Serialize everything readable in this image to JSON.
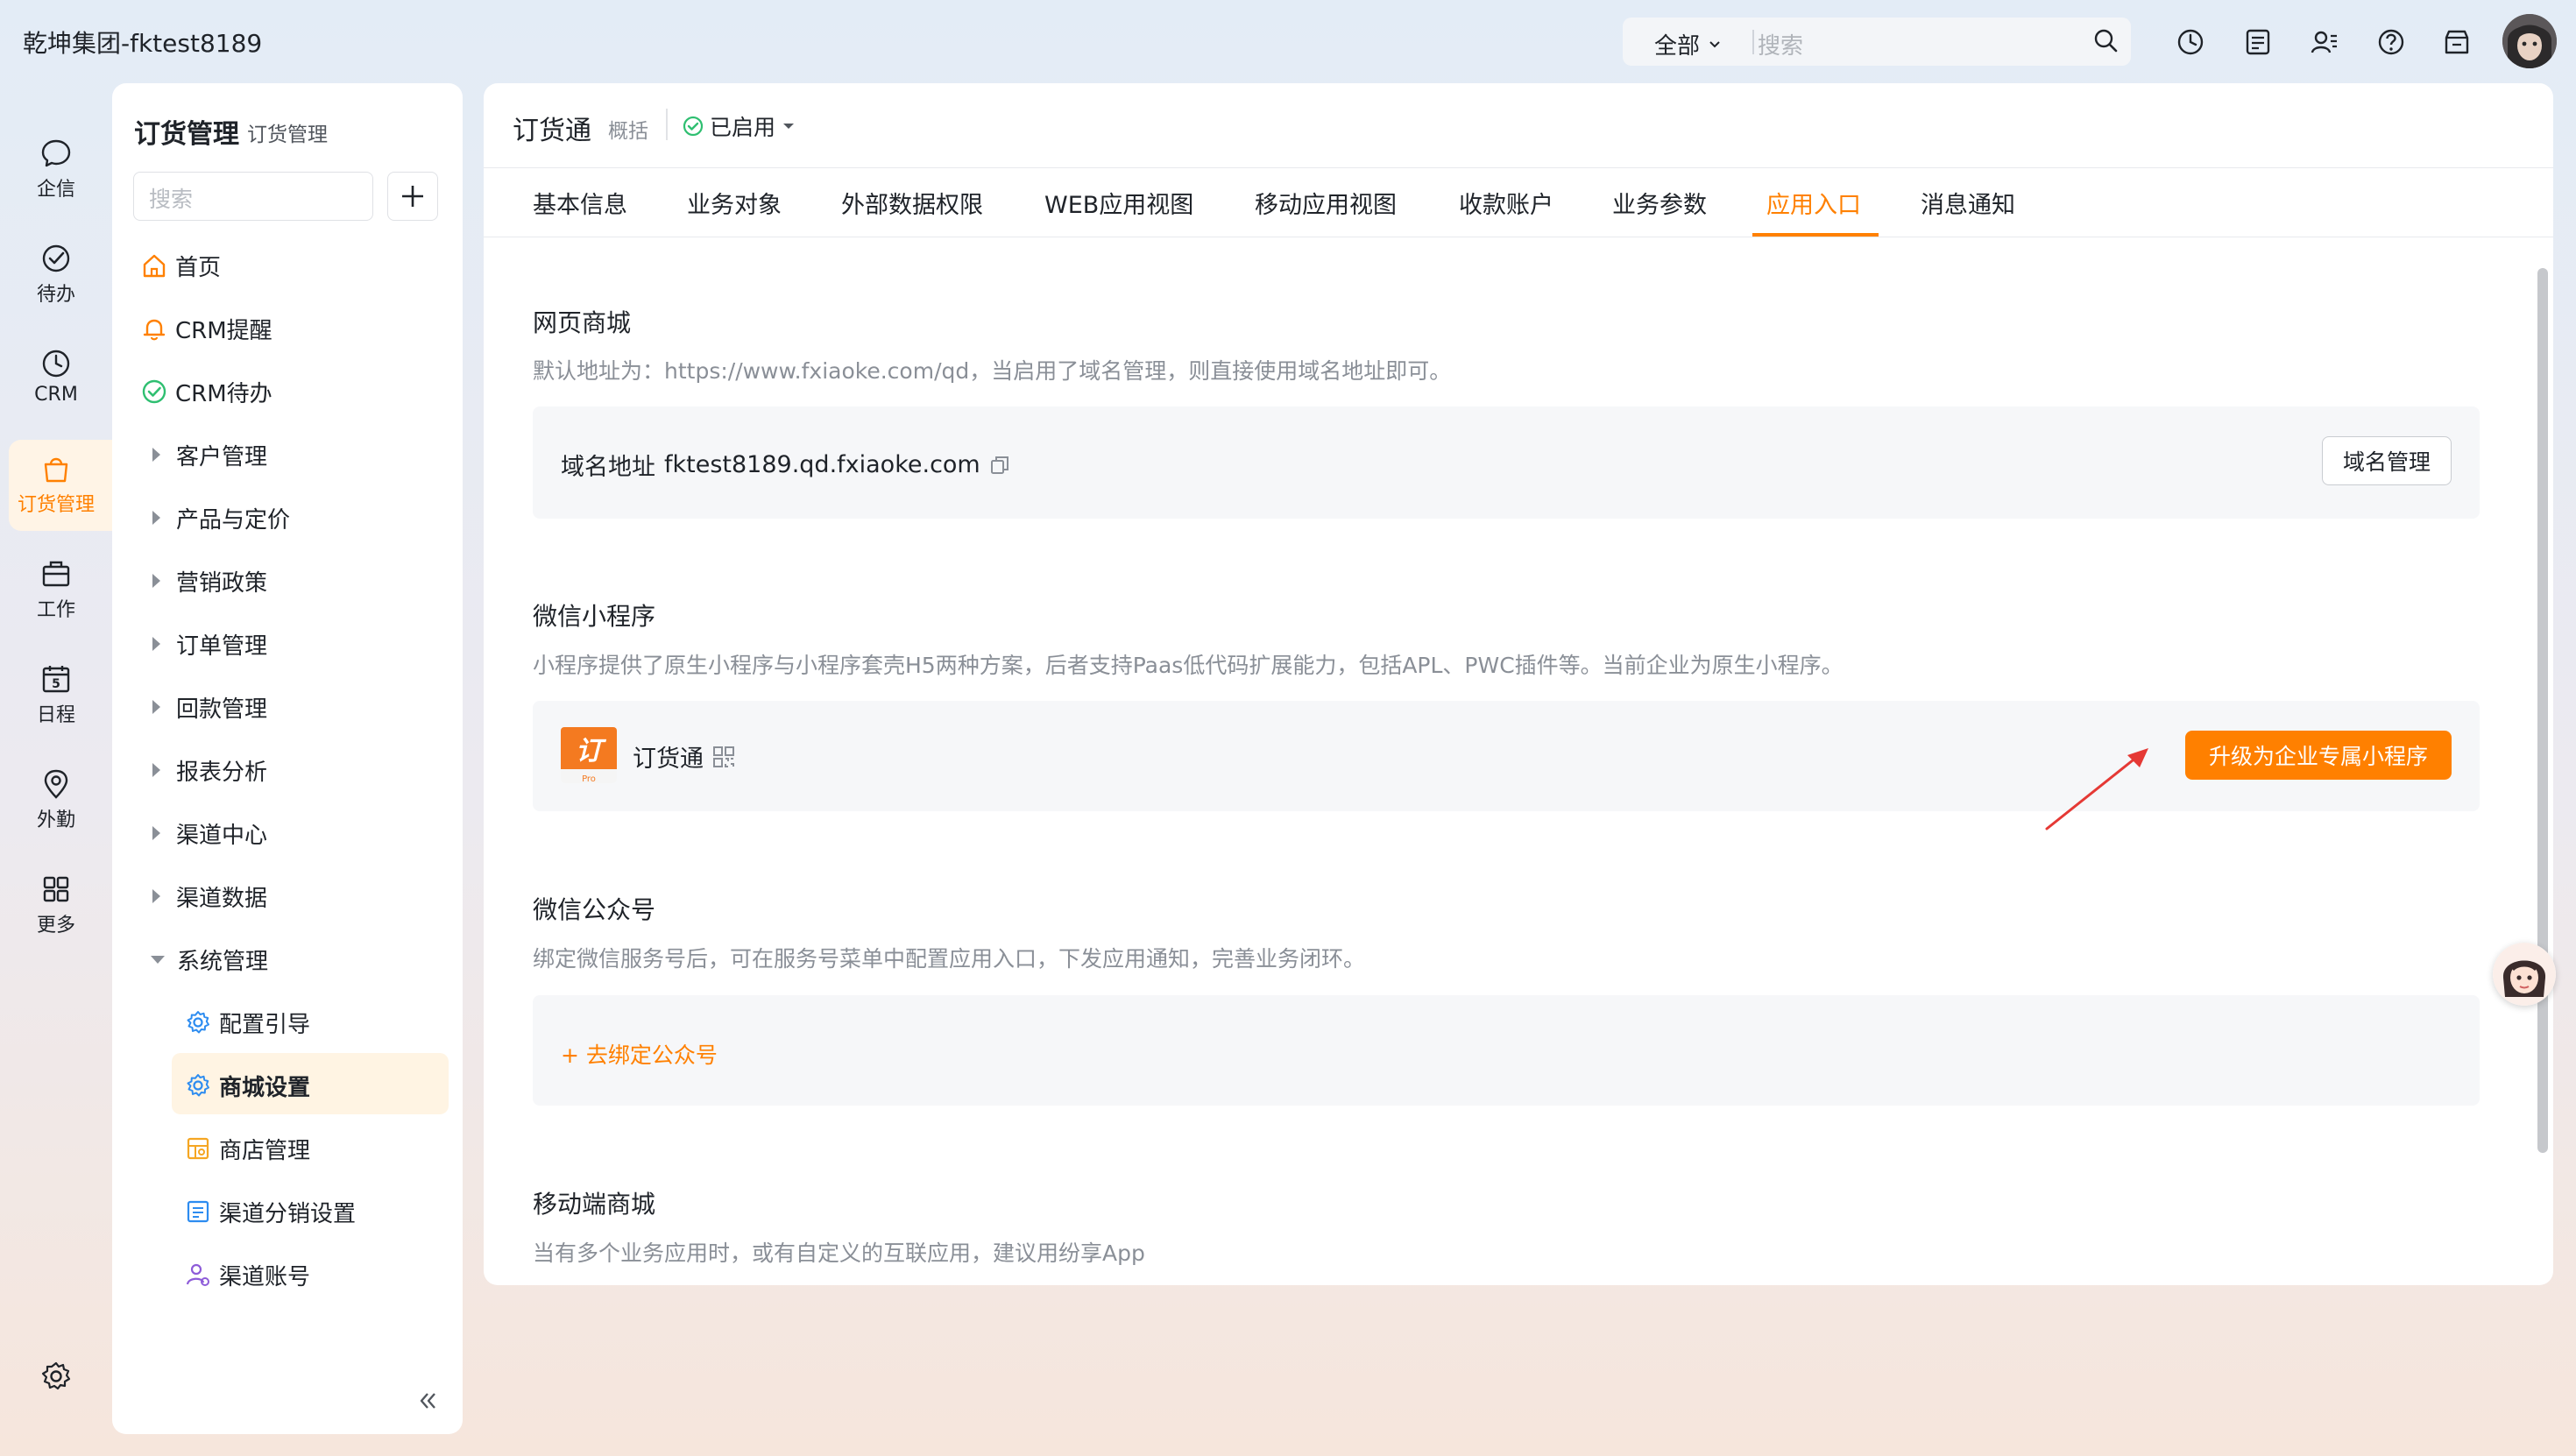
{
  "topbar": {
    "company": "乾坤集团-fktest8189",
    "search_scope": "全部",
    "search_placeholder": "搜索"
  },
  "rail": {
    "items": [
      {
        "label": "企信",
        "icon": "chat-bubble-icon"
      },
      {
        "label": "待办",
        "icon": "check-circle-icon"
      },
      {
        "label": "CRM",
        "icon": "clock-icon"
      },
      {
        "label": "订货管理",
        "icon": "shopping-bag-icon"
      },
      {
        "label": "工作",
        "icon": "briefcase-icon"
      },
      {
        "label": "日程",
        "icon": "calendar-icon"
      },
      {
        "label": "外勤",
        "icon": "location-pin-icon"
      },
      {
        "label": "更多",
        "icon": "grid-icon"
      }
    ],
    "calendar_day": "5"
  },
  "sidebar": {
    "title": "订货管理",
    "subtitle": "订货管理",
    "search_placeholder": "搜索",
    "items": [
      {
        "label": "首页"
      },
      {
        "label": "CRM提醒"
      },
      {
        "label": "CRM待办"
      },
      {
        "label": "客户管理"
      },
      {
        "label": "产品与定价"
      },
      {
        "label": "营销政策"
      },
      {
        "label": "订单管理"
      },
      {
        "label": "回款管理"
      },
      {
        "label": "报表分析"
      },
      {
        "label": "渠道中心"
      },
      {
        "label": "渠道数据"
      },
      {
        "label": "系统管理"
      }
    ],
    "sub_items": [
      {
        "label": "配置引导"
      },
      {
        "label": "商城设置"
      },
      {
        "label": "商店管理"
      },
      {
        "label": "渠道分销设置"
      },
      {
        "label": "渠道账号"
      }
    ]
  },
  "header": {
    "app_title": "订货通",
    "app_sub": "概括",
    "status": "已启用"
  },
  "tabs": [
    {
      "label": "基本信息"
    },
    {
      "label": "业务对象"
    },
    {
      "label": "外部数据权限"
    },
    {
      "label": "WEB应用视图"
    },
    {
      "label": "移动应用视图"
    },
    {
      "label": "收款账户"
    },
    {
      "label": "业务参数"
    },
    {
      "label": "应用入口"
    },
    {
      "label": "消息通知"
    }
  ],
  "sections": {
    "web": {
      "title": "网页商城",
      "desc": "默认地址为：https://www.fxiaoke.com/qd，当启用了域名管理，则直接使用域名地址即可。",
      "domain_label": "域名地址",
      "domain_value": "fktest8189.qd.fxiaoke.com",
      "button": "域名管理"
    },
    "mini": {
      "title": "微信小程序",
      "desc": "小程序提供了原生小程序与小程序套壳H5两种方案，后者支持Paas低代码扩展能力，包括APL、PWC插件等。当前企业为原生小程序。",
      "app_logo": "订",
      "app_logo_sub": "Pro",
      "app_name": "订货通",
      "button": "升级为企业专属小程序"
    },
    "official": {
      "title": "微信公众号",
      "desc": "绑定微信服务号后，可在服务号菜单中配置应用入口，下发应用通知，完善业务闭环。",
      "link": "+ 去绑定公众号"
    },
    "mobile": {
      "title": "移动端商城",
      "desc": "当有多个业务应用时，或有自定义的互联应用，建议用纷享App"
    }
  },
  "colors": {
    "accent": "#ff8000",
    "success": "#2fbf71",
    "arrow": "#e53935"
  }
}
